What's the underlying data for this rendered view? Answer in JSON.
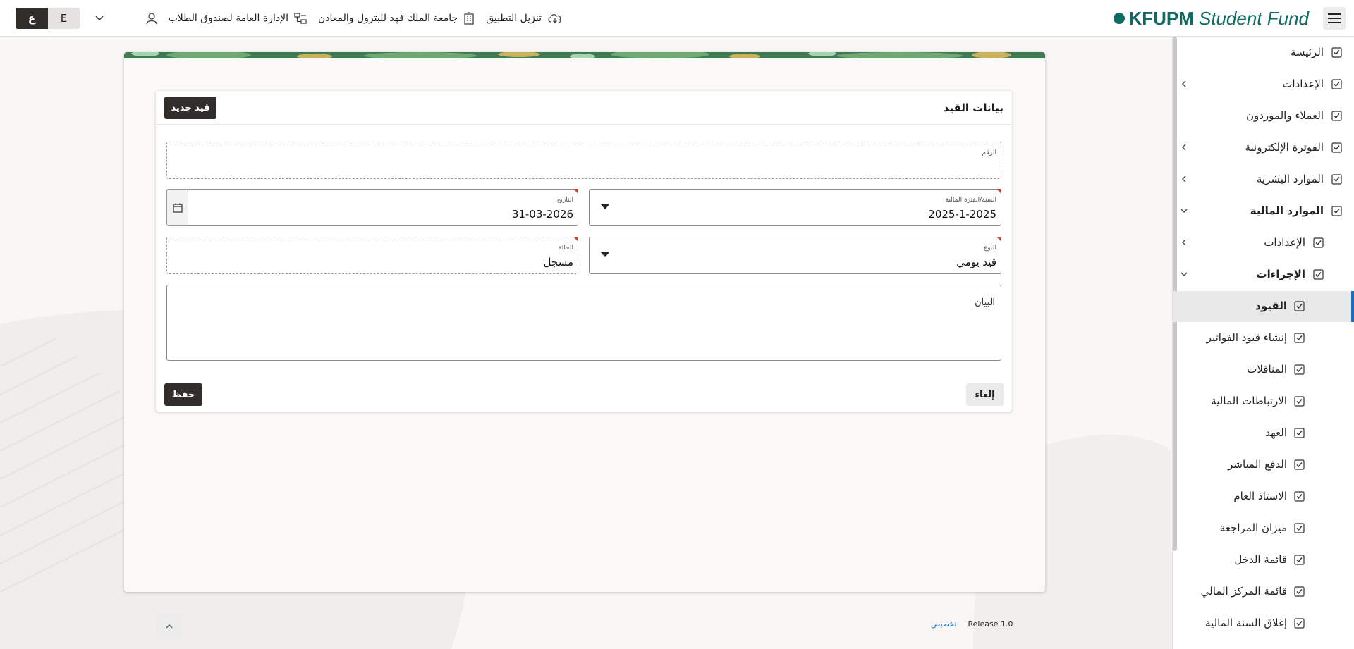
{
  "header": {
    "logo_primary": "KFUPM",
    "logo_secondary": "Student Fund",
    "links": [
      {
        "label": "تنزيل التطبيق",
        "icon": "cloud-download-icon"
      },
      {
        "label": "جامعة الملك فهد للبترول والمعادن",
        "icon": "building-icon"
      },
      {
        "label": "الإدارة العامة لصندوق الطلاب",
        "icon": "org-chart-icon"
      }
    ],
    "lang_ar": "ع",
    "lang_en": "E"
  },
  "sidebar": {
    "items": [
      {
        "label": "الرئيسة",
        "level": 0,
        "chevron": false
      },
      {
        "label": "الإعدادات",
        "level": 0,
        "chevron": "collapsed"
      },
      {
        "label": "العملاء والموردون",
        "level": 0,
        "chevron": false
      },
      {
        "label": "الفوترة الإلكترونية",
        "level": 0,
        "chevron": "collapsed"
      },
      {
        "label": "الموارد البشرية",
        "level": 0,
        "chevron": "collapsed"
      },
      {
        "label": "الموارد المالية",
        "level": 0,
        "chevron": "expanded",
        "bold": true
      },
      {
        "label": "الإعدادات",
        "level": 1,
        "chevron": "collapsed"
      },
      {
        "label": "الإجراءات",
        "level": 1,
        "chevron": "expanded",
        "bold": true
      },
      {
        "label": "القيود",
        "level": 2,
        "chevron": false,
        "bold": true,
        "selected": true
      },
      {
        "label": "إنشاء قيود الفواتير",
        "level": 2,
        "chevron": false
      },
      {
        "label": "المناقلات",
        "level": 2,
        "chevron": false
      },
      {
        "label": "الارتباطات المالية",
        "level": 2,
        "chevron": false
      },
      {
        "label": "العهد",
        "level": 2,
        "chevron": false
      },
      {
        "label": "الدفع المباشر",
        "level": 2,
        "chevron": false
      },
      {
        "label": "الاستاذ العام",
        "level": 2,
        "chevron": false
      },
      {
        "label": "ميزان المراجعة",
        "level": 2,
        "chevron": false
      },
      {
        "label": "قائمة الدخل",
        "level": 2,
        "chevron": false
      },
      {
        "label": "قائمة المركز المالي",
        "level": 2,
        "chevron": false
      },
      {
        "label": "إغلاق السنة المالية",
        "level": 2,
        "chevron": false
      }
    ]
  },
  "form": {
    "title": "بيانات القيد",
    "new_button": "قيد جديد",
    "number": {
      "label": "الرقم",
      "value": ""
    },
    "period": {
      "label": "السنة/الفترة المالية",
      "value": "2025-1-2025"
    },
    "date": {
      "label": "التاريخ",
      "value": "31-03-2026"
    },
    "type": {
      "label": "النوع",
      "value": "قيد يومي"
    },
    "status": {
      "label": "الحالة",
      "value": "مسجل"
    },
    "description": {
      "placeholder": "البيان",
      "value": ""
    },
    "cancel_button": "إلغاء",
    "save_button": "حفظ"
  },
  "footer": {
    "customize_link": "تخصيص",
    "release": "Release 1.0"
  },
  "colors": {
    "brand_teal": "#0e6b62",
    "dark_button": "#312d2a",
    "link_blue": "#1e6fba",
    "required_red": "#c74634"
  }
}
